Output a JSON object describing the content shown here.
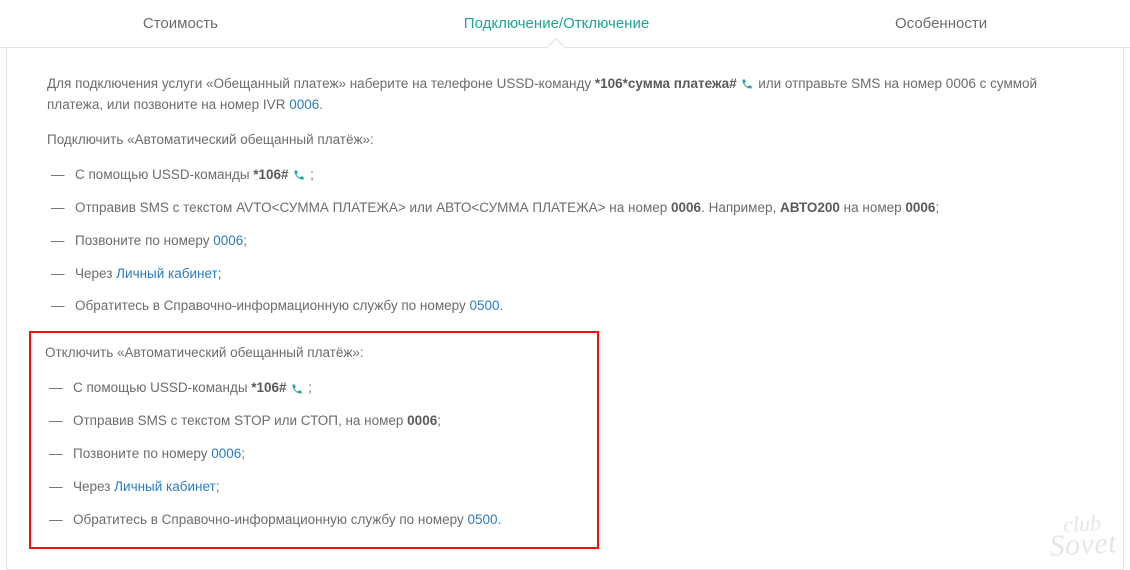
{
  "tabs": {
    "cost": "Стоимость",
    "connect": "Подключение/Отключение",
    "features": "Особенности"
  },
  "intro": {
    "p1a": "Для подключения услуги «Обещанный платеж» наберите на телефоне USSD-команду ",
    "ussd1": " *106*сумма платежа# ",
    "p1b": " или отправьте SMS на номер 0006 с суммой платежа, или позвоните на номер IVR ",
    "ivr_link": "0006",
    "p1c": "."
  },
  "section_on": {
    "title": "Подключить «Автоматический обещанный платёж»:",
    "i1a": "С помощью USSD-команды ",
    "i1b": " *106# ",
    "i1c": " ;",
    "i2a": "Отправив SMS с текстом AVTO<СУММА ПЛАТЕЖА> или АВТО<СУММА ПЛАТЕЖА> на номер ",
    "i2b": "0006",
    "i2c": ". Например, ",
    "i2d": "АВТО200",
    "i2e": " на номер ",
    "i2f": "0006",
    "i2g": ";",
    "i3a": "Позвоните по номеру ",
    "i3link": "0006",
    "i3b": ";",
    "i4a": "Через ",
    "i4link": "Личный кабинет",
    "i4b": ";",
    "i5a": "Обратитесь в Справочно-информационную службу по номеру ",
    "i5link": "0500",
    "i5b": "."
  },
  "section_off": {
    "title": "Отключить «Автоматический обещанный платёж»:",
    "i1a": "С помощью USSD-команды ",
    "i1b": " *106# ",
    "i1c": " ;",
    "i2a": "Отправив SMS с текстом STOP или СТОП, на номер ",
    "i2b": "0006",
    "i2c": ";",
    "i3a": "Позвоните по номеру ",
    "i3link": "0006",
    "i3b": ";",
    "i4a": "Через ",
    "i4link": "Личный кабинет",
    "i4b": ";",
    "i5a": "Обратитесь в Справочно-информационную службу по номеру ",
    "i5link": "0500",
    "i5b": "."
  },
  "watermark": {
    "l1": "club",
    "l2": "Sovet"
  }
}
